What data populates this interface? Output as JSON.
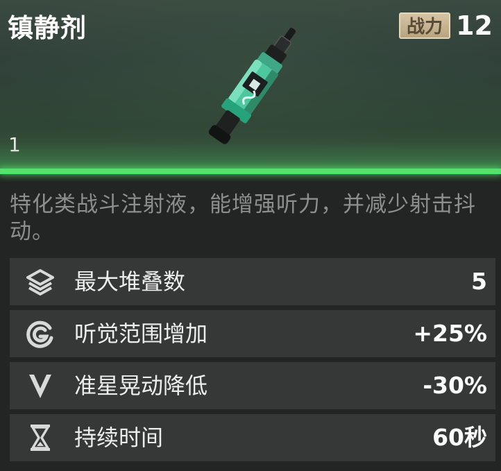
{
  "item": {
    "name": "镇静剂",
    "power_label": "战力",
    "power_value": "12",
    "count": "1",
    "image_icon": "syringe-icon",
    "description": "特化类战斗注射液，能增强听力，并减少射击抖动。"
  },
  "colors": {
    "rarity_green": "#54e36a",
    "power_badge": "#c9b692",
    "stat_row": "#363838",
    "description_text": "#8e8e8e"
  },
  "stats": [
    {
      "icon": "layers-icon",
      "label": "最大堆叠数",
      "value": "5"
    },
    {
      "icon": "hearing-icon",
      "label": "听觉范围增加",
      "value": "+25%"
    },
    {
      "icon": "crosshair-down-icon",
      "label": "准星晃动降低",
      "value": "-30%"
    },
    {
      "icon": "hourglass-icon",
      "label": "持续时间",
      "value": "60秒"
    }
  ]
}
